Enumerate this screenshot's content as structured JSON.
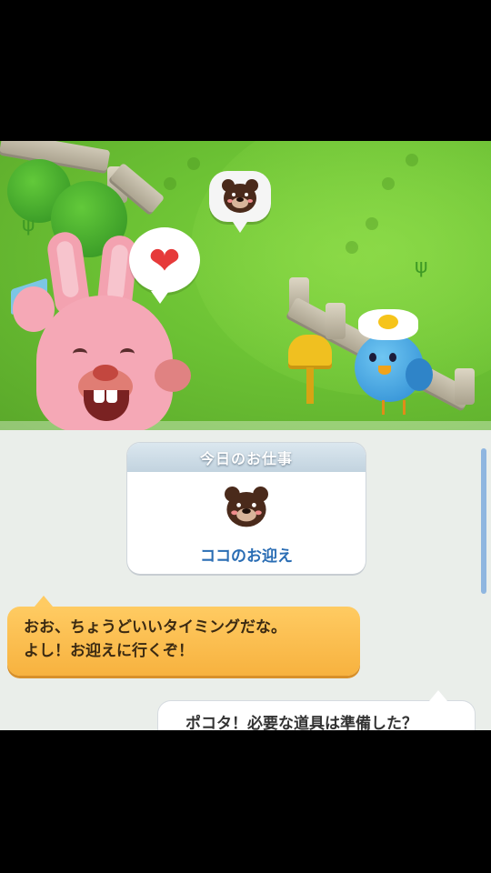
{
  "scene": {
    "heart_icon": "heart-icon",
    "marker_icon": "bear-head-icon",
    "characters": [
      "rabbit",
      "blue-bird",
      "bear"
    ]
  },
  "task_card": {
    "title": "今日のお仕事",
    "icon": "bear-head-icon",
    "task_name": "ココのお迎え"
  },
  "dialogue": {
    "line1": "おお、ちょうどいいタイミングだな。",
    "line2": "よし！お迎えに行くぞ！",
    "reply": "ポコタ！必要な道具は準備した？"
  },
  "colors": {
    "accent_orange": "#f7b23f",
    "task_name_blue": "#2a6db4",
    "heart_red": "#e63a3a"
  }
}
